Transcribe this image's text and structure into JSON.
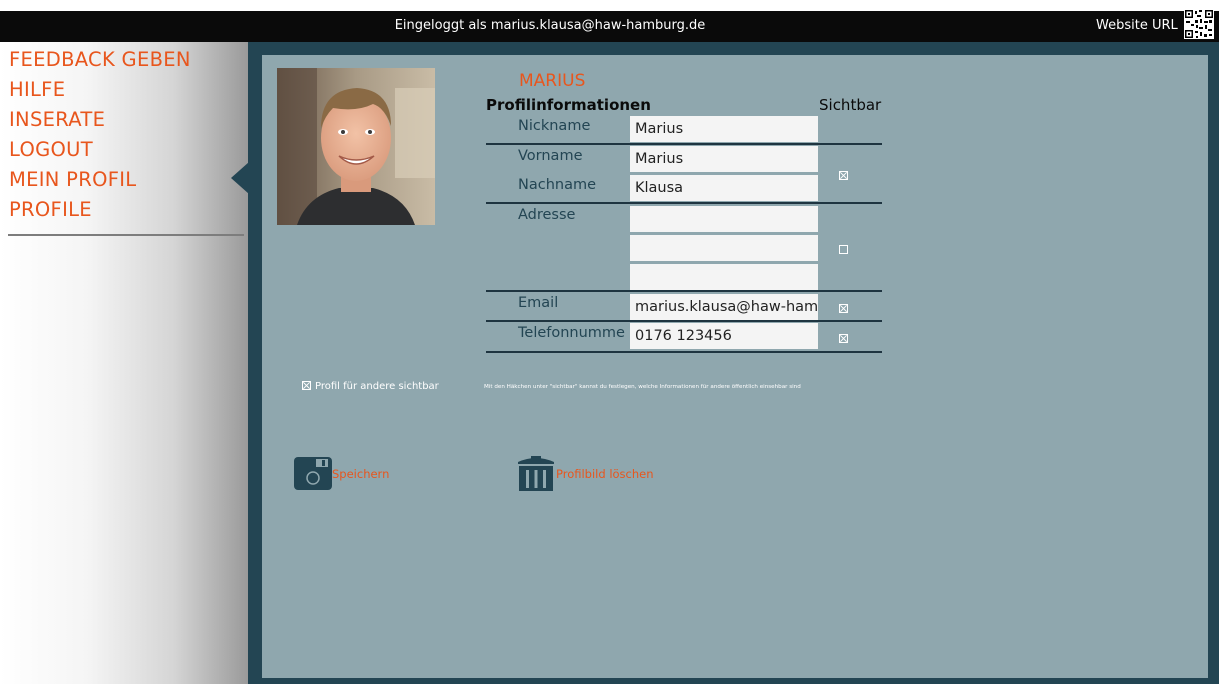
{
  "topbar": {
    "login_text": "Eingeloggt als marius.klausa@haw-hamburg.de",
    "website_url_label": "Website URL"
  },
  "sidebar": {
    "items": [
      {
        "label": "FEEDBACK GEBEN"
      },
      {
        "label": "HILFE"
      },
      {
        "label": "INSERATE"
      },
      {
        "label": "LOGOUT"
      },
      {
        "label": "MEIN PROFIL"
      },
      {
        "label": "PROFILE"
      }
    ]
  },
  "profile": {
    "display_name": "MARIUS",
    "section_title": "Profilinformationen",
    "visible_header": "Sichtbar",
    "fields": {
      "nickname": {
        "label": "Nickname",
        "value": "Marius"
      },
      "vorname": {
        "label": "Vorname",
        "value": "Marius"
      },
      "nachname": {
        "label": "Nachname",
        "value": "Klausa"
      },
      "adresse": {
        "label": "Adresse",
        "line1": "",
        "line2": "",
        "line3": ""
      },
      "email": {
        "label": "Email",
        "value": "marius.klausa@haw-hamb"
      },
      "telefon": {
        "label": "Telefonnumme",
        "value": "0176 123456"
      }
    },
    "visibility": {
      "name": true,
      "adresse": false,
      "email": true,
      "telefon": true
    },
    "profile_visible_label": "Profil für andere sichtbar",
    "profile_visible": true,
    "hint_text": "Mit den Häkchen unter \"sichtbar\" kannst du festlegen, welche Informationen für andere öffentlich einsehbar sind"
  },
  "actions": {
    "save_label": "Speichern",
    "delete_photo_label": "Profilbild löschen"
  },
  "colors": {
    "accent": "#e8561d",
    "panel": "#8fa7ae",
    "frame": "#234553"
  }
}
